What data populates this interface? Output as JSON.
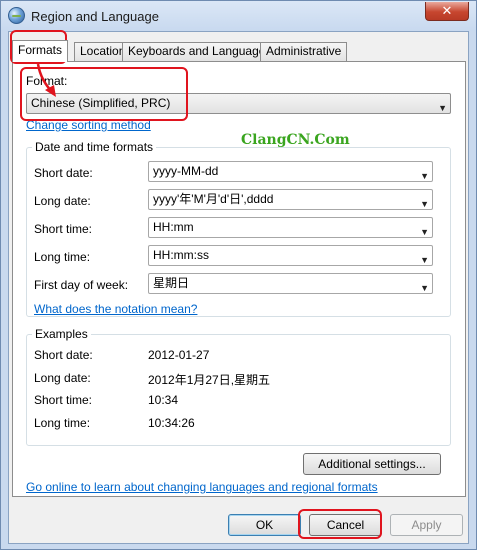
{
  "window": {
    "title": "Region and Language",
    "close_glyph": "✕"
  },
  "tabs": [
    {
      "label": "Formats",
      "active": true
    },
    {
      "label": "Location",
      "active": false
    },
    {
      "label": "Keyboards and Languages",
      "active": false
    },
    {
      "label": "Administrative",
      "active": false
    }
  ],
  "format": {
    "label": "Format:",
    "value": "Chinese (Simplified, PRC)",
    "sorting_link": "Change sorting method"
  },
  "watermark": "ClangCN.Com",
  "date_time": {
    "title": "Date and time formats",
    "rows": [
      {
        "label": "Short date:",
        "value": "yyyy-MM-dd"
      },
      {
        "label": "Long date:",
        "value": "yyyy'年'M'月'd'日',dddd"
      },
      {
        "label": "Short time:",
        "value": "HH:mm"
      },
      {
        "label": "Long time:",
        "value": "HH:mm:ss"
      },
      {
        "label": "First day of week:",
        "value": "星期日"
      }
    ],
    "notation_link": "What does the notation mean?"
  },
  "examples": {
    "title": "Examples",
    "rows": [
      {
        "label": "Short date:",
        "value": "2012-01-27"
      },
      {
        "label": "Long date:",
        "value": "2012年1月27日,星期五"
      },
      {
        "label": "Short time:",
        "value": "10:34"
      },
      {
        "label": "Long time:",
        "value": "10:34:26"
      }
    ]
  },
  "additional_settings": "Additional settings...",
  "online_link": "Go online to learn about changing languages and regional formats",
  "buttons": {
    "ok": "OK",
    "cancel": "Cancel",
    "apply": "Apply"
  },
  "icons": {
    "dropdown": "▼"
  },
  "colors": {
    "annotation_red": "#e0141e",
    "link_blue": "#0066cc",
    "watermark_green": "#3aa51f"
  }
}
